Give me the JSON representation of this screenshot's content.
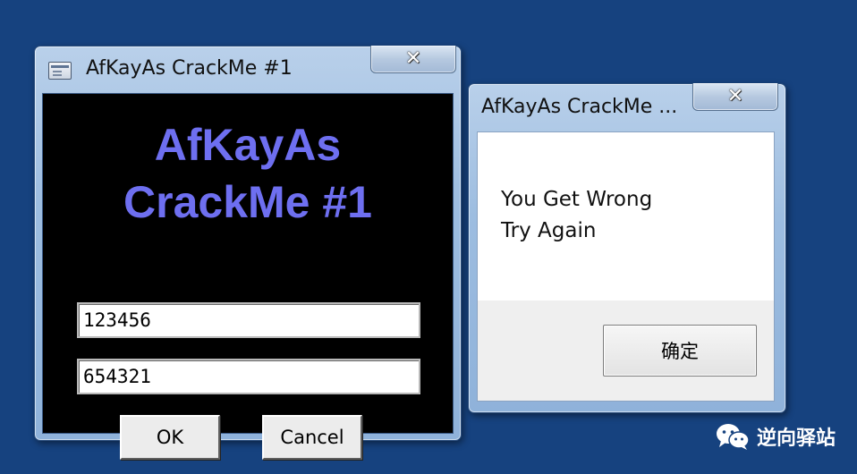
{
  "crackme_window": {
    "title": "AfKayAs CrackMe #1",
    "heading_line1": "AfKayAs",
    "heading_line2": "CrackMe #1",
    "name_value": "123456",
    "serial_value": "654321",
    "ok_label": "OK",
    "cancel_label": "Cancel",
    "close_glyph": "✕"
  },
  "message_box": {
    "title": "AfKayAs CrackMe ...",
    "line1": "You Get Wrong",
    "line2": "Try Again",
    "confirm_label": "确定",
    "close_glyph": "✕"
  },
  "watermark": {
    "text": "逆向驿站",
    "icon": "wechat-icon"
  },
  "colors": {
    "desktop": "#16427f",
    "heading": "#6e6ff0"
  }
}
